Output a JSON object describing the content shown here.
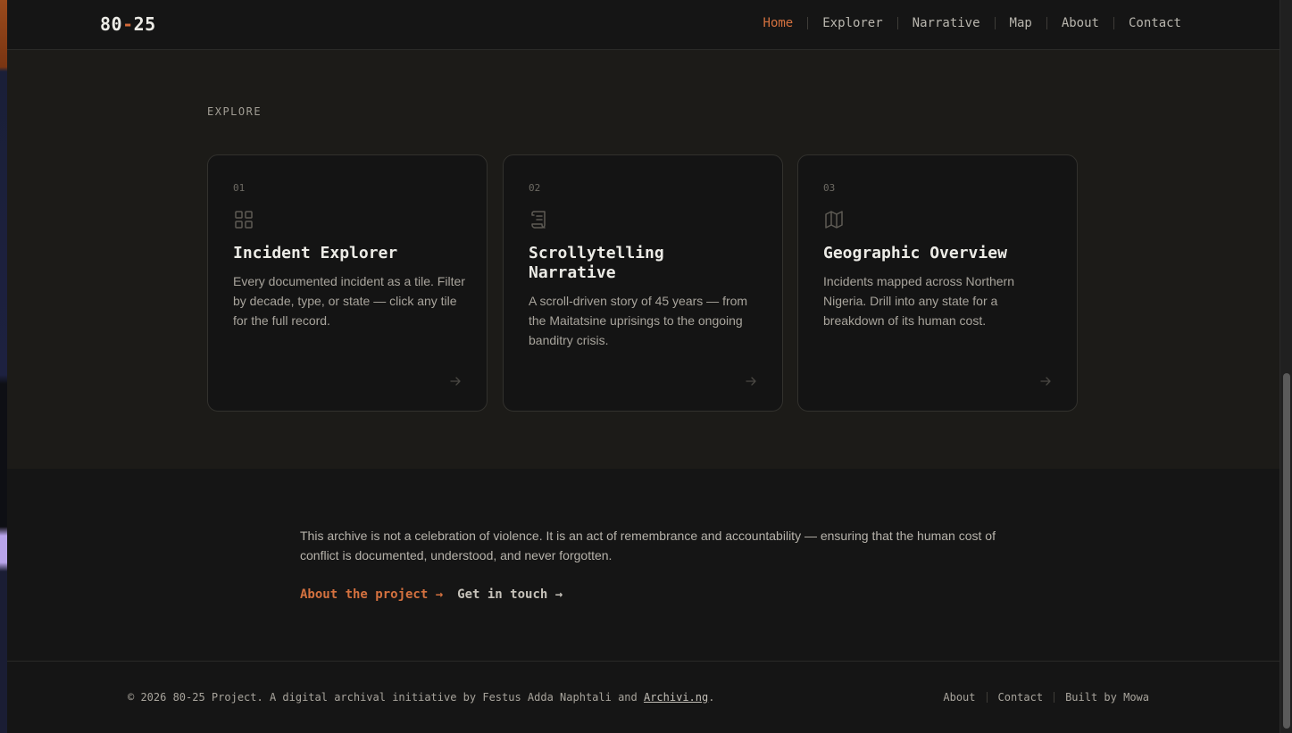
{
  "nav": {
    "logo_left": "80",
    "logo_dash": "-",
    "logo_right": "25",
    "links": [
      "Home",
      "Explorer",
      "Narrative",
      "Map",
      "About",
      "Contact"
    ],
    "active": "Home",
    "accent_color": "#d4713f"
  },
  "explore": {
    "label": "EXPLORE",
    "cards": [
      {
        "number": "01",
        "icon": "grid-icon",
        "title": "Incident Explorer",
        "description": "Every documented incident as a tile. Filter by decade, type, or state — click any tile for the full record."
      },
      {
        "number": "02",
        "icon": "scroll-icon",
        "title": "Scrollytelling Narrative",
        "description": "A scroll-driven story of 45 years — from the Maitatsine uprisings to the ongoing banditry crisis."
      },
      {
        "number": "03",
        "icon": "map-icon",
        "title": "Geographic Overview",
        "description": "Incidents mapped across Northern Nigeria. Drill into any state for a breakdown of its human cost."
      }
    ]
  },
  "mission": {
    "text": "This archive is not a celebration of violence. It is an act of remembrance and accountability — ensuring that the human cost of conflict is documented, understood, and never forgotten.",
    "link_about": "About the project →",
    "link_contact": "Get in touch →"
  },
  "footer": {
    "copyright_prefix": "© 2026 80-25 Project. A digital archival initiative by Festus Adda Naphtali and ",
    "copyright_link": "Archivi.ng",
    "copyright_suffix": ".",
    "links": [
      "About",
      "Contact",
      "Built by Mowa"
    ]
  }
}
